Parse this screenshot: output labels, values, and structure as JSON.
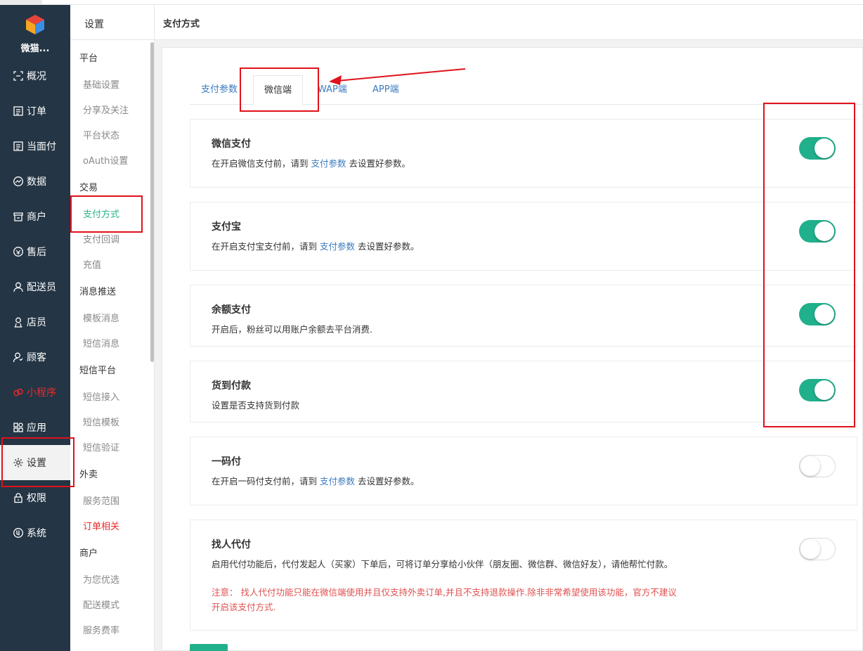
{
  "app": {
    "logo_text": "微猫..."
  },
  "nav": [
    {
      "key": "overview",
      "label": "概况",
      "icon": "overview-icon"
    },
    {
      "key": "orders",
      "label": "订单",
      "icon": "list-icon"
    },
    {
      "key": "facepay",
      "label": "当面付",
      "icon": "list-icon"
    },
    {
      "key": "data",
      "label": "数据",
      "icon": "chart-icon"
    },
    {
      "key": "merchant",
      "label": "商户",
      "icon": "store-icon"
    },
    {
      "key": "aftersale",
      "label": "售后",
      "icon": "aftersale-icon"
    },
    {
      "key": "courier",
      "label": "配送员",
      "icon": "user-icon"
    },
    {
      "key": "clerk",
      "label": "店员",
      "icon": "user-icon"
    },
    {
      "key": "customer",
      "label": "顾客",
      "icon": "user-icon"
    },
    {
      "key": "miniapp",
      "label": "小程序",
      "icon": "miniapp-icon"
    },
    {
      "key": "apps",
      "label": "应用",
      "icon": "apps-icon"
    },
    {
      "key": "settings",
      "label": "设置",
      "icon": "gear-icon"
    },
    {
      "key": "permission",
      "label": "权限",
      "icon": "lock-icon"
    },
    {
      "key": "system",
      "label": "系统",
      "icon": "system-icon"
    }
  ],
  "submenu": {
    "title": "设置",
    "groups": [
      {
        "label": "平台",
        "items": [
          "基础设置",
          "分享及关注",
          "平台状态",
          "oAuth设置"
        ]
      },
      {
        "label": "交易",
        "items": [
          "支付方式",
          "支付回调",
          "充值"
        ]
      },
      {
        "label": "消息推送",
        "items": [
          "模板消息",
          "短信消息"
        ]
      },
      {
        "label": "短信平台",
        "items": [
          "短信接入",
          "短信模板",
          "短信验证"
        ]
      },
      {
        "label": "外卖",
        "items": [
          "服务范围",
          "订单相关"
        ]
      },
      {
        "label": "商户",
        "items": [
          "为您优选",
          "配送模式",
          "服务费率"
        ]
      }
    ]
  },
  "header": {
    "title": "支付方式"
  },
  "tabs": [
    "支付参数",
    "微信端",
    "WAP端",
    "APP端"
  ],
  "active_tab": "微信端",
  "cards": [
    {
      "title": "微信支付",
      "desc_pre": "在开启微信支付前，请到 ",
      "desc_link": "支付参数",
      "desc_post": " 去设置好参数。",
      "enabled": true
    },
    {
      "title": "支付宝",
      "desc_pre": "在开启支付宝支付前，请到 ",
      "desc_link": "支付参数",
      "desc_post": " 去设置好参数。",
      "enabled": true
    },
    {
      "title": "余额支付",
      "desc": "开启后，粉丝可以用账户余额去平台消费.",
      "enabled": true
    },
    {
      "title": "货到付款",
      "desc": "设置是否支持货到付款",
      "enabled": true
    },
    {
      "title": "一码付",
      "desc_pre": "在开启一码付支付前，请到 ",
      "desc_link": "支付参数",
      "desc_post": " 去设置好参数。",
      "enabled": false
    },
    {
      "title": "找人代付",
      "desc": "启用代付功能后，代付发起人（买家）下单后，可将订单分享给小伙伴（朋友圈、微信群、微信好友），请他帮忙付款。",
      "warning": "注意： 找人代付功能只能在微信端使用并且仅支持外卖订单,并且不支持退款操作.除非非常希望使用该功能，官方不建议开启该支付方式.",
      "enabled": false
    }
  ],
  "colors": {
    "sidebar": "#243545",
    "accent": "#21b08c",
    "link": "#3a7bbf",
    "highlight_red": "#e82b2b",
    "annotation_red": "#e0121b"
  }
}
